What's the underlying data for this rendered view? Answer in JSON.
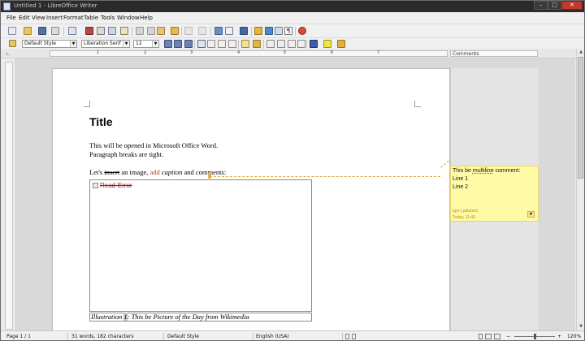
{
  "window": {
    "title": "Untitled 1 - LibreOffice Writer"
  },
  "menu": [
    "File",
    "Edit",
    "View",
    "Insert",
    "Format",
    "Table",
    "Tools",
    "Window",
    "Help"
  ],
  "formatting": {
    "style": "Default Style",
    "font": "Liberation Serif",
    "size": "12"
  },
  "ruler": {
    "numbers": [
      "1",
      "2",
      "3",
      "4",
      "5",
      "6",
      "7"
    ]
  },
  "sidebar": {
    "comments_header": "Comments"
  },
  "document": {
    "title": "Title",
    "line1": "This will be opened in Microsoft Office Word.",
    "line2": "Paragraph breaks are tight.",
    "line3": {
      "p1": "Let's ",
      "deleted": "insert",
      "p2": " an image, ",
      "inserted": "add",
      "p3": " ",
      "italic": "caption",
      "p4": " and comments:"
    },
    "image_error": "Read-Error",
    "caption": {
      "pre": "Illustration ",
      "num": "1",
      "post": ": This be Picture of the Day from Wikimedia"
    }
  },
  "comment": {
    "pre": "This be ",
    "underlined": "multiline",
    "post": " comment:",
    "line2": "Line 1",
    "line3": "Line 2",
    "author": "Igor Ljubuncic",
    "time": "Today, 11:43"
  },
  "status": {
    "page": "Page 1 / 1",
    "words": "31 words, 182 characters",
    "style": "Default Style",
    "language": "English (USA)",
    "zoom": "120%"
  },
  "colors": {
    "accent_change": "#c0392b",
    "comment_bg": "#fffaa5"
  }
}
